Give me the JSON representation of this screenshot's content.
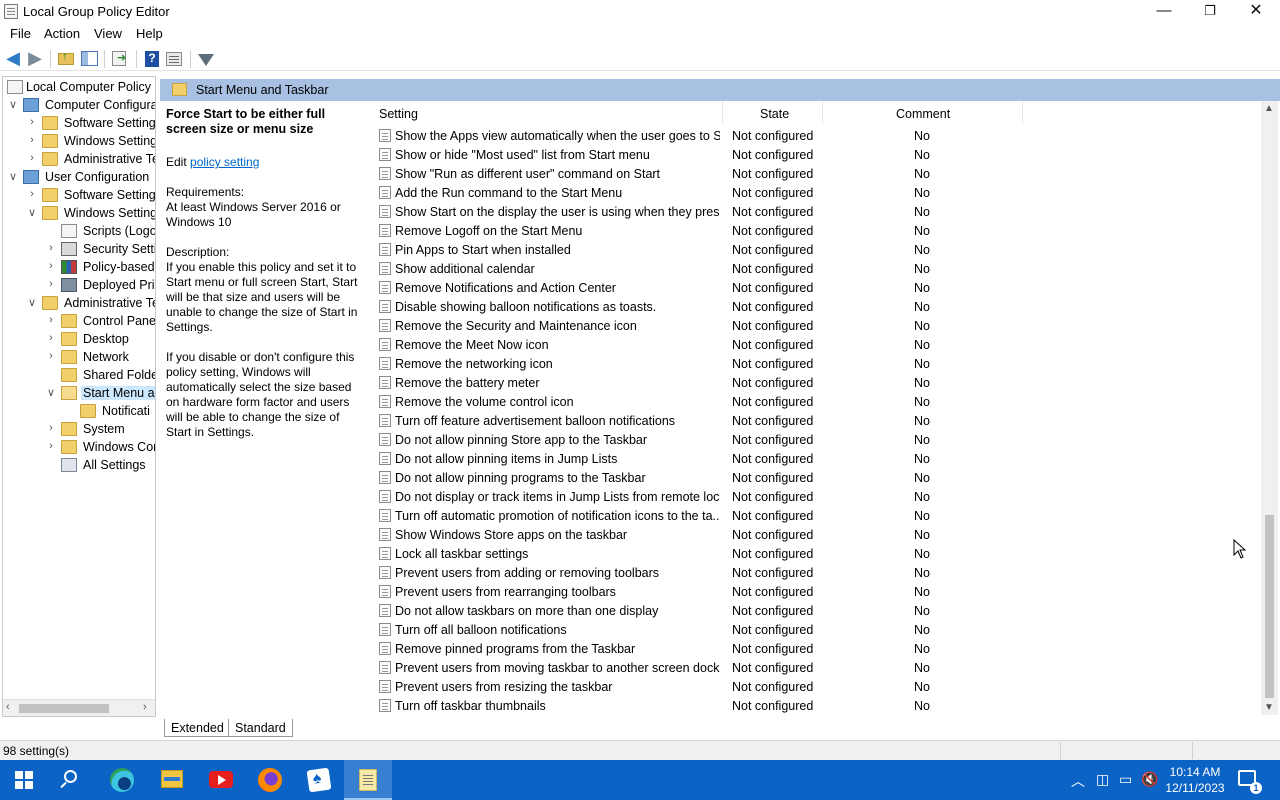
{
  "window": {
    "title": "Local Group Policy Editor",
    "minimize": "—",
    "maximize": "❐",
    "close": "✕"
  },
  "menu": [
    "File",
    "Action",
    "View",
    "Help"
  ],
  "tree": [
    {
      "label": "Local Computer Policy",
      "level": 0,
      "icon": "policy-doc-icon",
      "expander": ""
    },
    {
      "label": "Computer Configura",
      "level": 1,
      "icon": "computer-icon",
      "expander": "∨"
    },
    {
      "label": "Software Settings",
      "level": 2,
      "icon": "folder-icon",
      "expander": "›"
    },
    {
      "label": "Windows Setting",
      "level": 2,
      "icon": "folder-icon",
      "expander": "›"
    },
    {
      "label": "Administrative Te",
      "level": 2,
      "icon": "folder-icon",
      "expander": "›"
    },
    {
      "label": "User Configuration",
      "level": 1,
      "icon": "computer-icon",
      "expander": "∨"
    },
    {
      "label": "Software Settings",
      "level": 2,
      "icon": "folder-icon",
      "expander": "›"
    },
    {
      "label": "Windows Setting",
      "level": 2,
      "icon": "folder-icon",
      "expander": "∨"
    },
    {
      "label": "Scripts (Logon",
      "level": 3,
      "icon": "scripts-icon",
      "expander": ""
    },
    {
      "label": "Security Settin",
      "level": 3,
      "icon": "security-icon",
      "expander": "›"
    },
    {
      "label": "Policy-based",
      "level": 3,
      "icon": "chart-icon",
      "expander": "›"
    },
    {
      "label": "Deployed Prin",
      "level": 3,
      "icon": "printer-icon",
      "expander": "›"
    },
    {
      "label": "Administrative Te",
      "level": 2,
      "icon": "folder-icon",
      "expander": "∨"
    },
    {
      "label": "Control Panel",
      "level": 3,
      "icon": "folder-icon",
      "expander": "›"
    },
    {
      "label": "Desktop",
      "level": 3,
      "icon": "folder-icon",
      "expander": "›"
    },
    {
      "label": "Network",
      "level": 3,
      "icon": "folder-icon",
      "expander": "›"
    },
    {
      "label": "Shared Folder",
      "level": 3,
      "icon": "folder-icon",
      "expander": ""
    },
    {
      "label": "Start Menu ar",
      "level": 3,
      "icon": "folder-open-icon",
      "expander": "∨",
      "selected": true
    },
    {
      "label": "Notificati",
      "level": 4,
      "icon": "folder-icon",
      "expander": ""
    },
    {
      "label": "System",
      "level": 3,
      "icon": "folder-icon",
      "expander": "›"
    },
    {
      "label": "Windows Cor",
      "level": 3,
      "icon": "folder-icon",
      "expander": "›"
    },
    {
      "label": "All Settings",
      "level": 3,
      "icon": "settings-icon",
      "expander": ""
    }
  ],
  "header": {
    "title": "Start Menu and Taskbar"
  },
  "description": {
    "title": "Force Start to be either full screen size or menu size",
    "edit_prefix": "Edit ",
    "edit_link": "policy setting ",
    "requirements_label": "Requirements:",
    "requirements": "At least Windows Server 2016 or Windows 10",
    "description_label": "Description:",
    "p1": "If you enable this policy and set it to Start menu or full screen Start, Start will be that size and users will be unable to change the size of Start in Settings.",
    "p2": "If you disable or don't configure this policy setting, Windows will automatically select the size based on hardware form factor and users will be able to change the size of Start in Settings."
  },
  "columns": {
    "setting": "Setting",
    "state": "State",
    "comment": "Comment"
  },
  "rows": [
    {
      "setting": "Show the Apps view automatically when the user goes to St...",
      "state": "Not configured",
      "comment": "No"
    },
    {
      "setting": "Show or hide \"Most used\" list from Start menu",
      "state": "Not configured",
      "comment": "No"
    },
    {
      "setting": "Show \"Run as different user\" command on Start",
      "state": "Not configured",
      "comment": "No"
    },
    {
      "setting": "Add the Run command to the Start Menu",
      "state": "Not configured",
      "comment": "No"
    },
    {
      "setting": "Show Start on the display the user is using when they press t...",
      "state": "Not configured",
      "comment": "No"
    },
    {
      "setting": "Remove Logoff on the Start Menu",
      "state": "Not configured",
      "comment": "No"
    },
    {
      "setting": "Pin Apps to Start when installed",
      "state": "Not configured",
      "comment": "No"
    },
    {
      "setting": "Show additional calendar",
      "state": "Not configured",
      "comment": "No"
    },
    {
      "setting": "Remove Notifications and Action Center",
      "state": "Not configured",
      "comment": "No"
    },
    {
      "setting": "Disable showing balloon notifications as toasts.",
      "state": "Not configured",
      "comment": "No"
    },
    {
      "setting": "Remove the Security and Maintenance icon",
      "state": "Not configured",
      "comment": "No"
    },
    {
      "setting": "Remove the Meet Now icon",
      "state": "Not configured",
      "comment": "No"
    },
    {
      "setting": "Remove the networking icon",
      "state": "Not configured",
      "comment": "No"
    },
    {
      "setting": "Remove the battery meter",
      "state": "Not configured",
      "comment": "No"
    },
    {
      "setting": "Remove the volume control icon",
      "state": "Not configured",
      "comment": "No"
    },
    {
      "setting": "Turn off feature advertisement balloon notifications",
      "state": "Not configured",
      "comment": "No"
    },
    {
      "setting": "Do not allow pinning Store app to the Taskbar",
      "state": "Not configured",
      "comment": "No"
    },
    {
      "setting": "Do not allow pinning items in Jump Lists",
      "state": "Not configured",
      "comment": "No"
    },
    {
      "setting": "Do not allow pinning programs to the Taskbar",
      "state": "Not configured",
      "comment": "No"
    },
    {
      "setting": "Do not display or track items in Jump Lists from remote loca...",
      "state": "Not configured",
      "comment": "No"
    },
    {
      "setting": "Turn off automatic promotion of notification icons to the ta...",
      "state": "Not configured",
      "comment": "No"
    },
    {
      "setting": "Show Windows Store apps on the taskbar",
      "state": "Not configured",
      "comment": "No"
    },
    {
      "setting": "Lock all taskbar settings",
      "state": "Not configured",
      "comment": "No"
    },
    {
      "setting": "Prevent users from adding or removing toolbars",
      "state": "Not configured",
      "comment": "No"
    },
    {
      "setting": "Prevent users from rearranging toolbars",
      "state": "Not configured",
      "comment": "No"
    },
    {
      "setting": "Do not allow taskbars on more than one display",
      "state": "Not configured",
      "comment": "No"
    },
    {
      "setting": "Turn off all balloon notifications",
      "state": "Not configured",
      "comment": "No"
    },
    {
      "setting": "Remove pinned programs from the Taskbar",
      "state": "Not configured",
      "comment": "No"
    },
    {
      "setting": "Prevent users from moving taskbar to another screen dock l...",
      "state": "Not configured",
      "comment": "No"
    },
    {
      "setting": "Prevent users from resizing the taskbar",
      "state": "Not configured",
      "comment": "No"
    },
    {
      "setting": "Turn off taskbar thumbnails",
      "state": "Not configured",
      "comment": "No"
    }
  ],
  "tabs": [
    "Extended",
    "Standard"
  ],
  "status": {
    "text": "98 setting(s)"
  },
  "taskbar": {
    "apps": [
      "start-icon",
      "search-icon",
      "edge-icon",
      "file-explorer-icon",
      "youtube-icon",
      "firefox-icon",
      "solitaire-icon",
      "notepad-icon"
    ],
    "time": "10:14 AM",
    "date": "12/11/2023",
    "notification_count": "1"
  },
  "colors": {
    "header_bar": "#a8c1e3",
    "taskbar": "#0c63c6",
    "link": "#0066cc",
    "selection": "#cce8ff"
  }
}
